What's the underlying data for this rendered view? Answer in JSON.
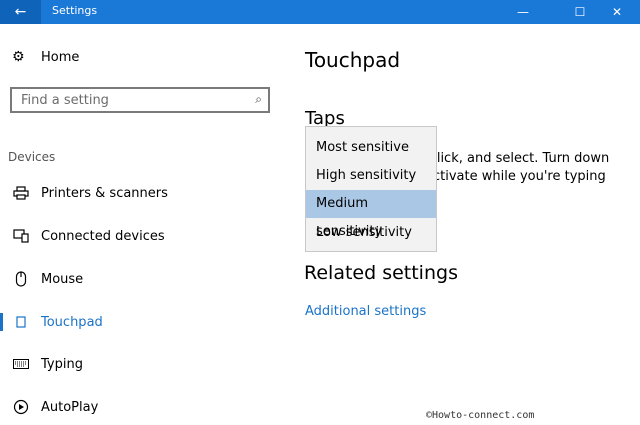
{
  "window": {
    "title": "Settings",
    "back_glyph": "←",
    "min_glyph": "—",
    "max_glyph": "☐",
    "close_glyph": "✕"
  },
  "sidebar": {
    "home_label": "Home",
    "search_placeholder": "Find a setting",
    "section": "Devices",
    "items": [
      {
        "label": "Printers & scanners",
        "icon": "printer-icon"
      },
      {
        "label": "Connected devices",
        "icon": "connected-devices-icon"
      },
      {
        "label": "Mouse",
        "icon": "mouse-icon"
      },
      {
        "label": "Touchpad",
        "icon": "touchpad-icon",
        "active": true
      },
      {
        "label": "Typing",
        "icon": "keyboard-icon"
      },
      {
        "label": "AutoPlay",
        "icon": "autoplay-icon"
      }
    ]
  },
  "main": {
    "title": "Touchpad",
    "taps_heading": "Taps",
    "taps_line1": "-click, and select. Turn down",
    "taps_line2": "ctivate while you're typing",
    "related_heading": "Related settings",
    "additional_link": "Additional settings"
  },
  "dropdown": {
    "options": [
      "Most sensitive",
      "High sensitivity",
      "Medium sensitivity",
      "Low sensitivity"
    ],
    "selected": "Medium sensitivity"
  },
  "watermark": "©Howto-connect.com",
  "colors": {
    "accent": "#1a73c8",
    "titlebar": "#1a78d6",
    "selected_option": "#aac8e5"
  }
}
